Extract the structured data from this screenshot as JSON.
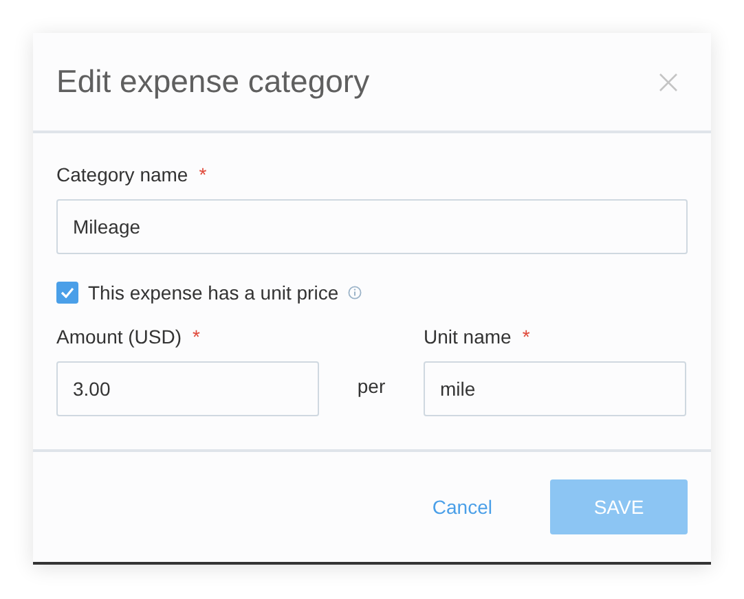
{
  "dialog": {
    "title": "Edit expense category"
  },
  "category_field": {
    "label": "Category name",
    "required_mark": "*",
    "value": "Mileage"
  },
  "unit_price_checkbox": {
    "label": "This expense has a unit price",
    "checked": true
  },
  "amount_field": {
    "label": "Amount (USD)",
    "required_mark": "*",
    "value": "3.00"
  },
  "per_label": "per",
  "unit_field": {
    "label": "Unit name",
    "required_mark": "*",
    "value": "mile"
  },
  "buttons": {
    "cancel": "Cancel",
    "save": {
      "label": "SAVE",
      "disabled": true
    }
  }
}
